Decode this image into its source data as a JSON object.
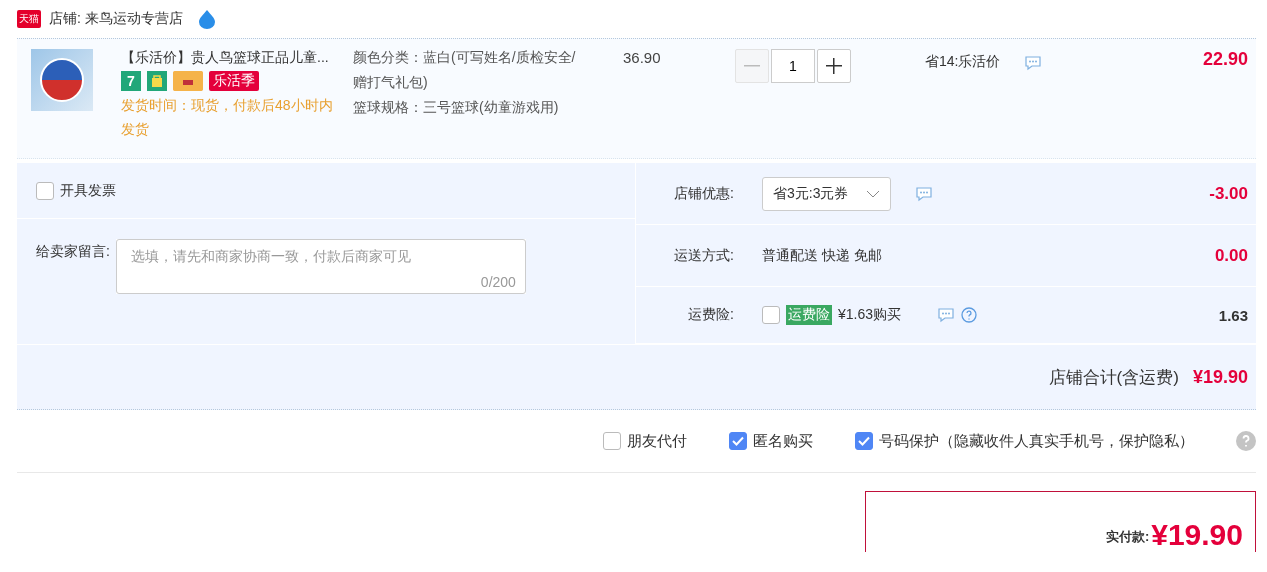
{
  "shop": {
    "badge": "天猫",
    "name": "店铺: 来鸟运动专营店"
  },
  "item": {
    "title": "【乐活价】贵人鸟篮球正品儿童...",
    "tags": [
      {
        "kind": "seven",
        "label": "7"
      },
      {
        "kind": "bag"
      },
      {
        "kind": "card"
      },
      {
        "kind": "text",
        "label": "乐活季"
      }
    ],
    "shipping_note": "发货时间：现货，付款后48小时内发货",
    "specs": [
      "颜色分类：蓝白(可写姓名/质检安全/赠打气礼包)",
      "篮球规格：三号篮球(幼童游戏用)"
    ],
    "unit_price": "36.90",
    "quantity": "1",
    "decrement_disabled": true,
    "discount": "省14:乐活价",
    "subtotal": "22.90"
  },
  "invoice": {
    "label": "开具发票",
    "checked": false
  },
  "message": {
    "label": "给卖家留言:",
    "placeholder": "选填，请先和商家协商一致，付款后商家可见",
    "counter": "0/200"
  },
  "summary_rows": [
    {
      "kind": "coupon",
      "label": "店铺优惠:",
      "value": "省3元:3元券",
      "amount": "-3.00"
    },
    {
      "kind": "text",
      "label": "运送方式:",
      "value": "普通配送 快递 免邮",
      "amount": "0.00"
    },
    {
      "kind": "insurance",
      "label": "运费险:",
      "checked": false,
      "tag": "运费险",
      "value": "¥1.63购买",
      "amount": "1.63"
    }
  ],
  "shop_total": {
    "label": "店铺合计(含运费)",
    "amount": "¥19.90"
  },
  "options": [
    {
      "label": "朋友代付",
      "checked": false
    },
    {
      "label": "匿名购买",
      "checked": true
    },
    {
      "label": "号码保护（隐藏收件人真实手机号，保护隐私）",
      "checked": true
    }
  ],
  "payment": {
    "label": "实付款:",
    "amount": "¥19.90"
  }
}
